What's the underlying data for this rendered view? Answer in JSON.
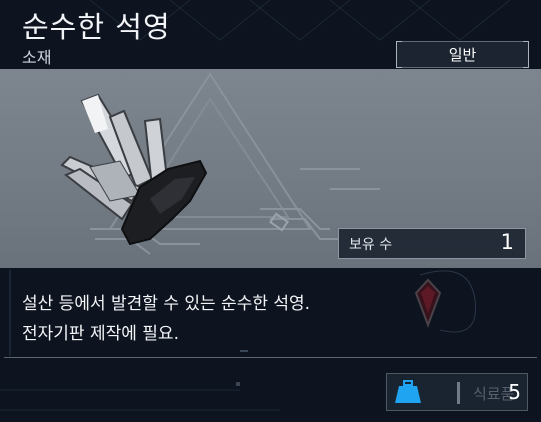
{
  "item": {
    "name": "순수한 석영",
    "category": "소재",
    "rarity": "일반",
    "owned_label": "보유 수",
    "owned_count": "1",
    "description_lines": [
      "설산 등에서 발견할 수 있는 순수한 석영.",
      "전자기판 제작에 필요."
    ]
  },
  "bag": {
    "icon": "weight-bag-icon",
    "hint": "식료품",
    "count": "5"
  },
  "colors": {
    "background": "#0d1420",
    "panel": "#737b85",
    "accent_blue": "#1fa4f2",
    "gem_red": "#8b1c24"
  }
}
